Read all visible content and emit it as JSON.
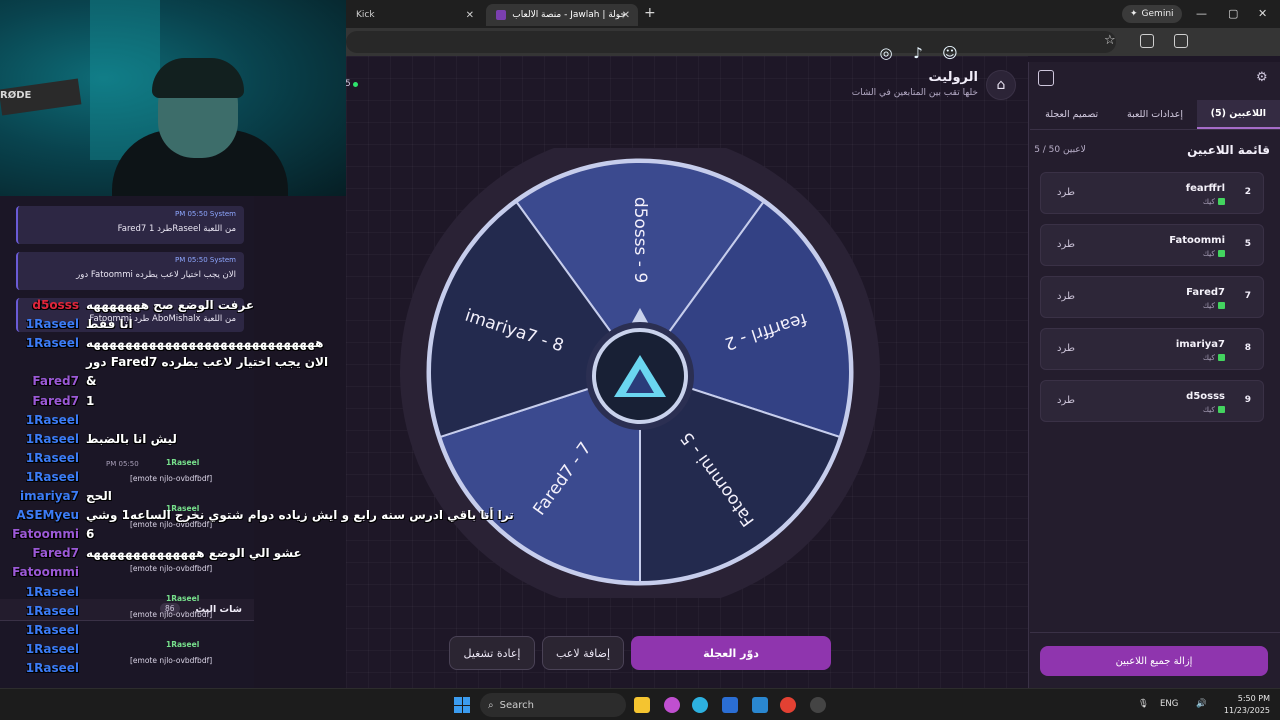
{
  "browser": {
    "tabs": [
      {
        "title": "Kick",
        "active": false
      },
      {
        "title": "جولة | Jawlah - منصة الألعاب الت",
        "active": true
      }
    ],
    "new_tab": "+",
    "gemini_label": "Gemini",
    "window_controls": [
      "—",
      "▢",
      "✕"
    ]
  },
  "header": {
    "title": "الروليت",
    "subtitle": "خلها تقب بين المتابعين في الشات",
    "status_count": "5",
    "social_icons": [
      "instagram-icon",
      "tiktok-icon",
      "snapchat-icon",
      "x-icon",
      "youtube-icon"
    ]
  },
  "wheel": {
    "segments": [
      {
        "label": "d5osss - 9",
        "color": "#3b4a8f"
      },
      {
        "label": "fearffrl - 2",
        "color": "#334184"
      },
      {
        "label": "Fatoommi - 5",
        "color": "#232a4e"
      },
      {
        "label": "Fared7 - 7",
        "color": "#3b4a8f"
      },
      {
        "label": "imariya7 - 8",
        "color": "#232a4e"
      }
    ],
    "rim_color": "#2a2235",
    "border_color": "#c6cdec"
  },
  "controls": {
    "spin": "دوّر العجلة",
    "add_player": "إضافة لاعب",
    "restart": "إعادة تشغيل"
  },
  "panel": {
    "tabs": [
      "اللاعبين (5)",
      "إعدادات اللعبة",
      "تصميم العجلة"
    ],
    "list_title": "قائمة اللاعبين",
    "list_count": "5 / 50 لاعبين",
    "platform": "كيك",
    "kick_label": "طرد",
    "players": [
      {
        "num": "2",
        "name": "fearffrl"
      },
      {
        "num": "5",
        "name": "Fatoommi"
      },
      {
        "num": "7",
        "name": "Fared7"
      },
      {
        "num": "8",
        "name": "imariya7"
      },
      {
        "num": "9",
        "name": "d5osss"
      }
    ],
    "clear_all": "إزالة جميع اللاعبين"
  },
  "webcam": {
    "mic_brand": "RØDE"
  },
  "site_chat": {
    "title": "شات البث",
    "count": "86",
    "system_cards": [
      {
        "sender": "System",
        "time": "PM 05:50",
        "text": "Fared7 طرد 1Raseel من اللعبة"
      },
      {
        "sender": "System",
        "time": "PM 05:50",
        "text": "دور Fatoommi الان يجب اختيار لاعب يطرده"
      },
      {
        "sender": "System",
        "time": "",
        "text": "Fatoommi طرد AboMishalx من اللعبة"
      }
    ],
    "kick_messages": [
      {
        "user": "1Raseel",
        "time": "PM 05:50",
        "text": "[emote njlo-ovbdfbdf]"
      },
      {
        "user": "1Raseel",
        "time": "PM 05:50",
        "text": "[emote njlo-ovbdfbdf]"
      },
      {
        "user": "1Raseel",
        "time": "PM 05:50",
        "text": "[emote njlo-ovbdfbdf]"
      },
      {
        "user": "1Raseel",
        "time": "PM 05:50",
        "text": "[emote njlo-ovbdfbdf]"
      },
      {
        "user": "1Raseel",
        "time": "PM 05:50",
        "text": "[emote njlo-ovbdfbdf]"
      }
    ]
  },
  "stream_chat": [
    {
      "user": "d5osss",
      "color": "#e0263c",
      "text": "عرفت الوضع صح هههههههه"
    },
    {
      "user": "1Raseel",
      "color": "#3c7cf6",
      "text": "انا فقط"
    },
    {
      "user": "1Raseel",
      "color": "#3c7cf6",
      "text": "هههههههههههههههههههههههههههههه"
    },
    {
      "user": "",
      "color": "#a8a0b8",
      "text": "دور Fared7 الان يجب اختيار لاعب يطرده"
    },
    {
      "user": "Fared7",
      "color": "#9b59d6",
      "text": "&"
    },
    {
      "user": "Fared7",
      "color": "#9b59d6",
      "text": "1"
    },
    {
      "user": "1Raseel",
      "color": "#3c7cf6",
      "text": ""
    },
    {
      "user": "1Raseel",
      "color": "#3c7cf6",
      "text": "ليش انا بالضبط"
    },
    {
      "user": "1Raseel",
      "color": "#3c7cf6",
      "text": ""
    },
    {
      "user": "1Raseel",
      "color": "#3c7cf6",
      "text": ""
    },
    {
      "user": "imariya7",
      "color": "#3c7cf6",
      "text": "الحج"
    },
    {
      "user": "ASEMyeu",
      "color": "#3c7cf6",
      "text": "ترا أنا باقي ادرس سنه رابع و ايش زياده دوام شتوي نخرج الساعه1 وشي"
    },
    {
      "user": "Fatoommi",
      "color": "#9b59d6",
      "text": "6"
    },
    {
      "user": "Fared7",
      "color": "#9b59d6",
      "text": "عشو الي الوضع ههههههههههههههه"
    },
    {
      "user": "Fatoommi",
      "color": "#9b59d6",
      "text": ""
    },
    {
      "user": "1Raseel",
      "color": "#3c7cf6",
      "text": ""
    },
    {
      "user": "1Raseel",
      "color": "#3c7cf6",
      "text": ""
    },
    {
      "user": "1Raseel",
      "color": "#3c7cf6",
      "text": ""
    },
    {
      "user": "1Raseel",
      "color": "#3c7cf6",
      "text": ""
    },
    {
      "user": "1Raseel",
      "color": "#3c7cf6",
      "text": ""
    }
  ],
  "taskbar": {
    "search_placeholder": "Search",
    "language": "ENG",
    "time": "5:50 PM",
    "date": "11/23/2025"
  }
}
